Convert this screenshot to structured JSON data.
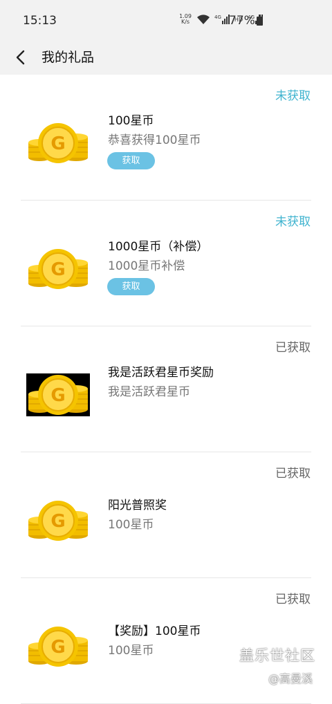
{
  "status_bar": {
    "time": "15:13",
    "net_speed_value": "1.09",
    "net_speed_unit": "K/s",
    "signal1_label": "4G",
    "hd_label": "HD",
    "signal2_label": "4G",
    "battery": "77%"
  },
  "header": {
    "title": "我的礼品"
  },
  "gifts": [
    {
      "name": "100星币",
      "desc": "恭喜获得100星币",
      "status": "未获取",
      "button": "获取"
    },
    {
      "name": "1000星币（补偿）",
      "desc": "1000星币补偿",
      "status": "未获取",
      "button": "获取"
    },
    {
      "name": "我是活跃君星币奖励",
      "desc": "我是活跃君星币",
      "status": "已获取"
    },
    {
      "name": "阳光普照奖",
      "desc": "100星币",
      "status": "已获取"
    },
    {
      "name": "【奖励】100星币",
      "desc": "100星币",
      "status": "已获取"
    }
  ],
  "watermark": {
    "title": "盖乐世社区",
    "user": "@高曼溪"
  },
  "colors": {
    "accent": "#6bc2e4",
    "unclaimed": "#3fb3cf",
    "claimed": "#666666",
    "coin_gold": "#f5c400"
  },
  "icons": {
    "back": "chevron-left-icon",
    "coin": "gold-coin-icon",
    "wifi": "wifi-icon",
    "signal": "signal-icon",
    "battery": "battery-icon"
  }
}
